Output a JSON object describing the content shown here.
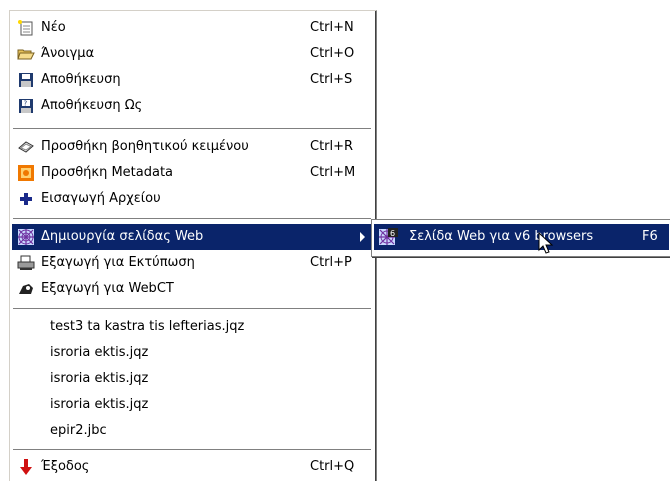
{
  "menu": {
    "items": [
      {
        "label": "Νέο",
        "shortcut": "Ctrl+N",
        "icon": "new-file-icon"
      },
      {
        "label": "Άνοιγμα",
        "shortcut": "Ctrl+O",
        "icon": "open-folder-icon"
      },
      {
        "label": "Αποθήκευση",
        "shortcut": "Ctrl+S",
        "icon": "save-icon"
      },
      {
        "label": "Αποθήκευση Ως",
        "shortcut": "",
        "icon": "save-as-icon"
      },
      {
        "label": "Προσθήκη βοηθητικού κειμένου",
        "shortcut": "Ctrl+R",
        "icon": "add-text-icon"
      },
      {
        "label": "Προσθήκη Metadata",
        "shortcut": "Ctrl+M",
        "icon": "metadata-icon"
      },
      {
        "label": "Εισαγωγή Αρχείου",
        "shortcut": "",
        "icon": "plus-icon"
      },
      {
        "label": "Δημιουργία σελίδας Web",
        "shortcut": "",
        "icon": "web-icon"
      },
      {
        "label": "Εξαγωγή για Εκτύπωση",
        "shortcut": "Ctrl+P",
        "icon": "print-icon"
      },
      {
        "label": "Εξαγωγή για WebCT",
        "shortcut": "",
        "icon": "webct-icon"
      }
    ],
    "recent_files": [
      "test3 ta kastra tis lefterias.jqz",
      "isroria ektis.jqz",
      "isroria ektis.jqz",
      "isroria ektis.jqz",
      "epir2.jbc"
    ],
    "exit": {
      "label": "Έξοδος",
      "shortcut": "Ctrl+Q",
      "icon": "exit-arrow-icon"
    }
  },
  "submenu": {
    "items": [
      {
        "label": "Σελίδα Web για v6 browsers",
        "shortcut": "F6",
        "icon": "web-page-v6-icon"
      }
    ]
  },
  "colors": {
    "highlight": "#0a246a",
    "highlight_text": "#ffffff"
  }
}
